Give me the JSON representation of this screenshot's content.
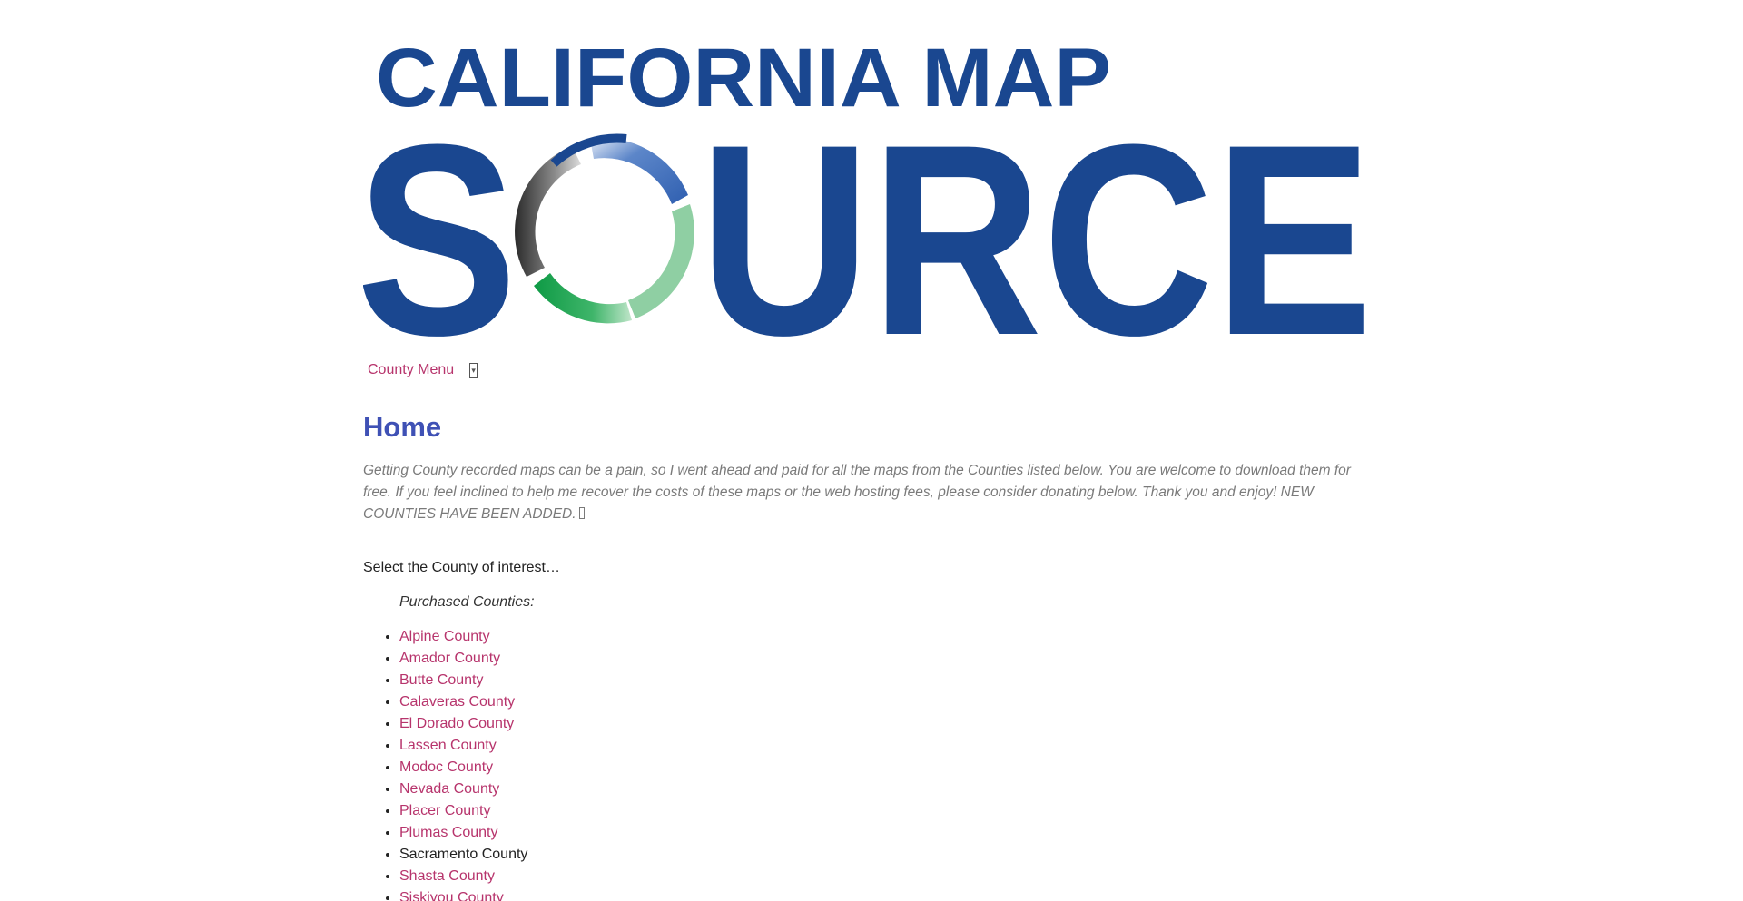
{
  "logo": {
    "line1": "CALIFORNIA MAP",
    "line2": "SOURCE",
    "brand_color": "#1a4790"
  },
  "nav": {
    "menu_label": "County Menu",
    "toggle_icon": "dropdown-toggle-icon"
  },
  "page": {
    "title": "Home",
    "intro": "Getting County recorded maps can be a pain, so I went ahead and paid for all the maps from the Counties listed below. You are welcome to download them for free.  If you feel inclined to help me recover the costs of these maps or the web hosting fees, please consider donating below. Thank you and enjoy!  NEW COUNTIES HAVE BEEN ADDED.",
    "select_label": "Select the County of interest…",
    "purchased_label": "Purchased Counties:"
  },
  "counties": [
    {
      "name": "Alpine County",
      "link": true
    },
    {
      "name": "Amador County",
      "link": true
    },
    {
      "name": "Butte County",
      "link": true
    },
    {
      "name": "Calaveras County",
      "link": true
    },
    {
      "name": "El Dorado County",
      "link": true
    },
    {
      "name": "Lassen County",
      "link": true
    },
    {
      "name": "Modoc County",
      "link": true
    },
    {
      "name": "Nevada County",
      "link": true
    },
    {
      "name": "Placer County",
      "link": true
    },
    {
      "name": "Plumas County",
      "link": true
    },
    {
      "name": "Sacramento County",
      "link": false
    },
    {
      "name": "Shasta County",
      "link": true
    },
    {
      "name": "Siskiyou County",
      "link": true
    }
  ],
  "colors": {
    "link": "#b7346c",
    "title": "#3f51b5",
    "intro": "#7a7a7a"
  }
}
